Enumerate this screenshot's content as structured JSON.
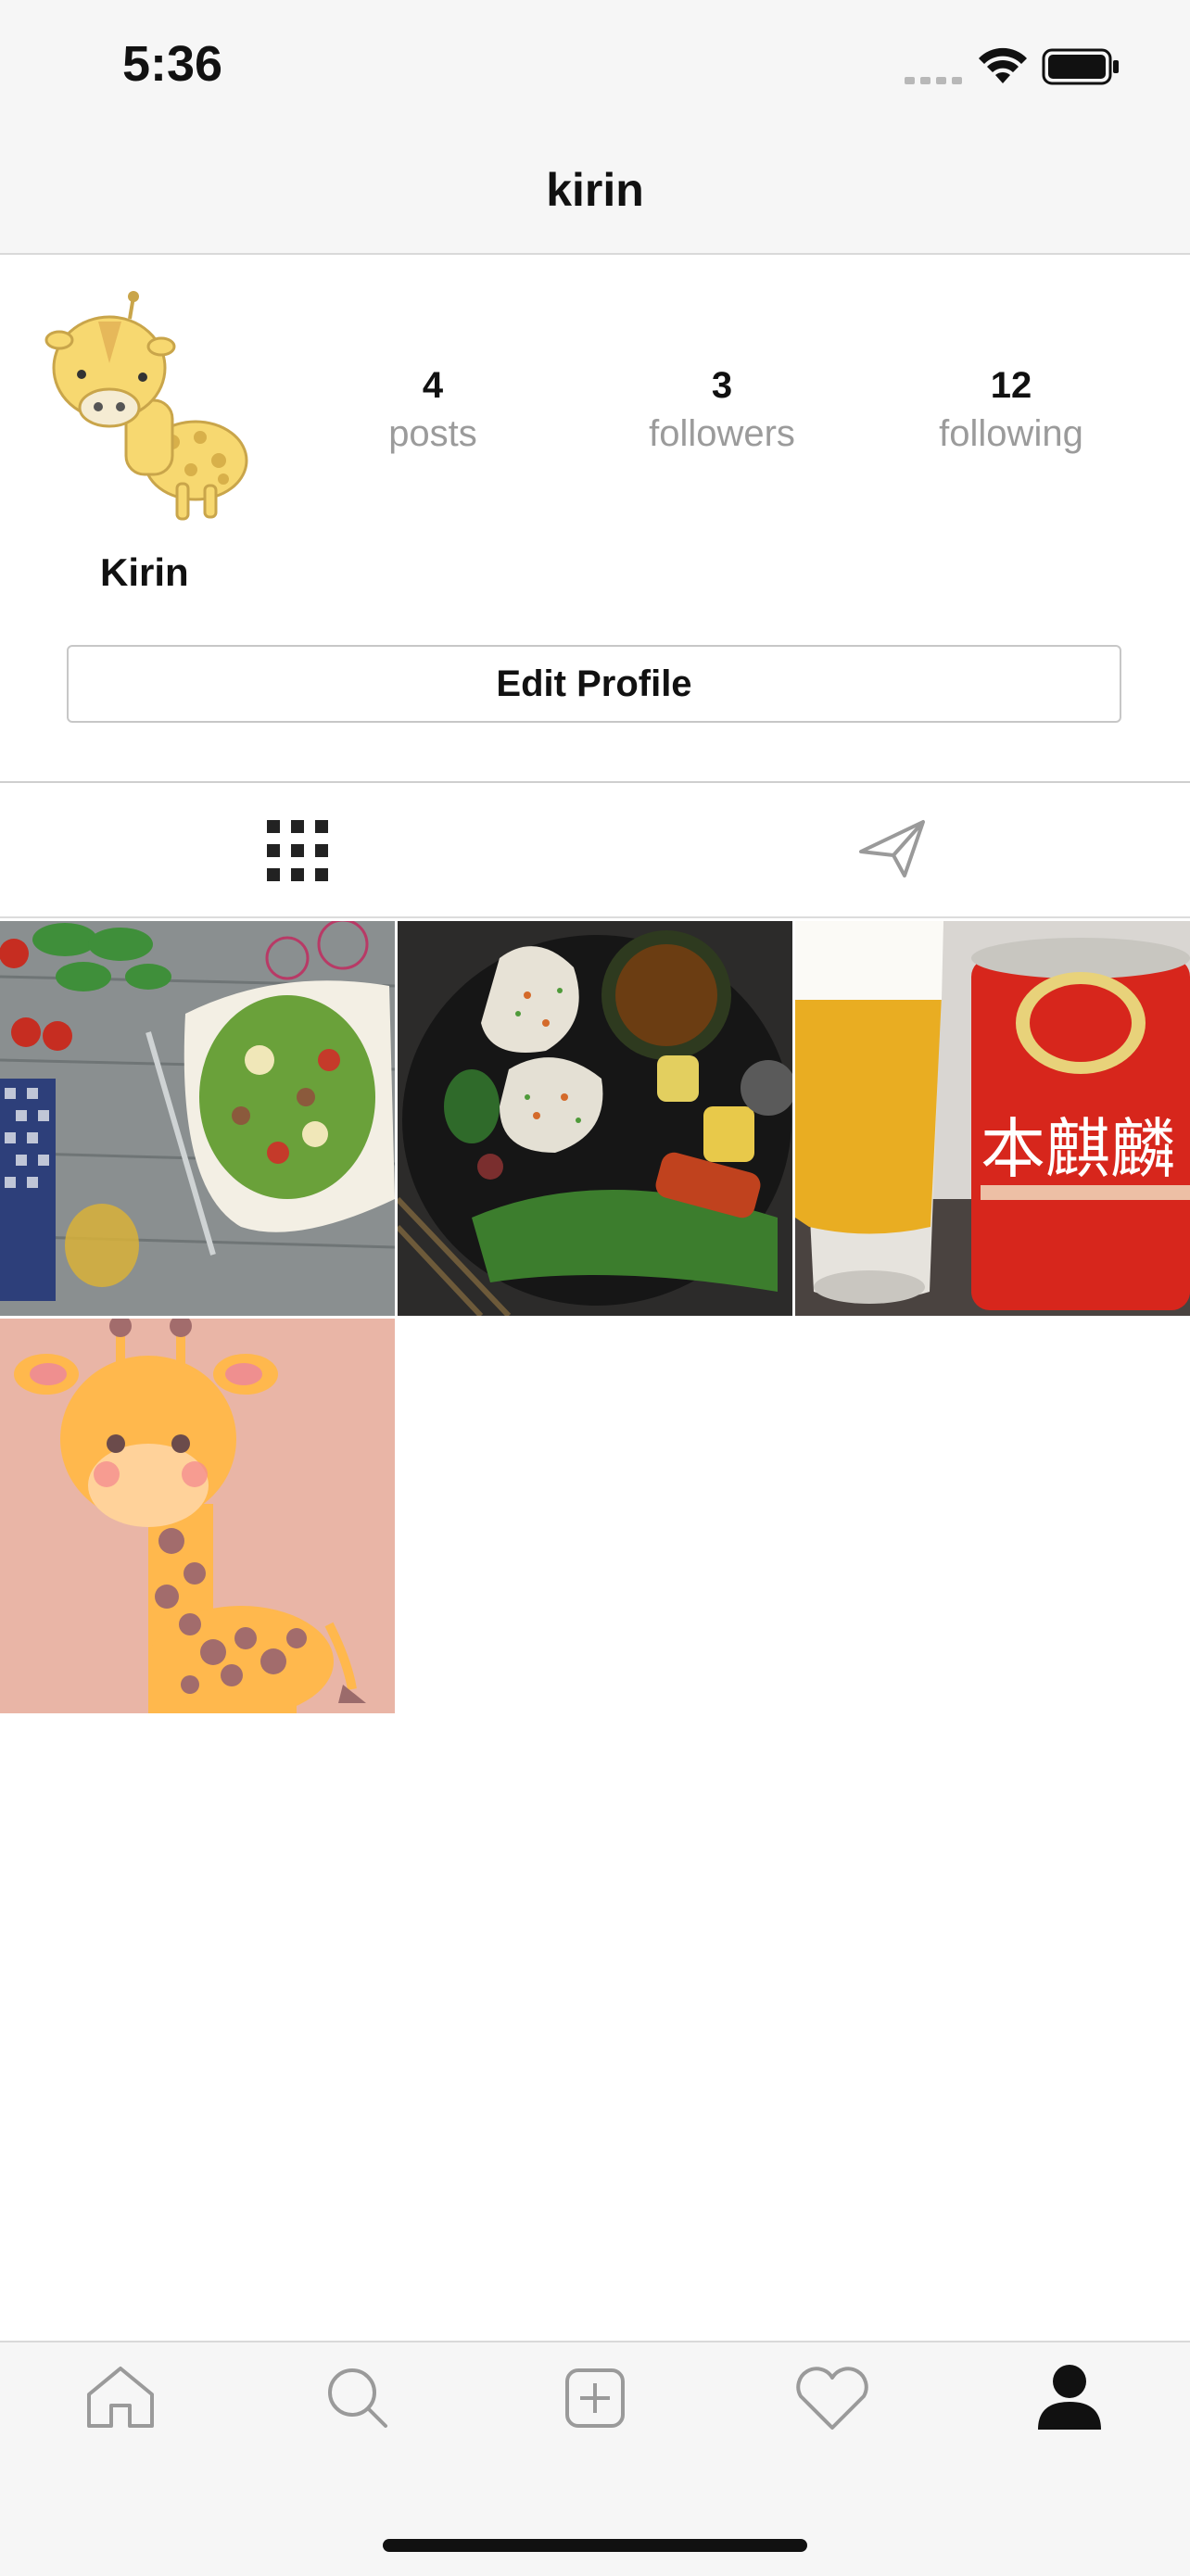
{
  "status_bar": {
    "time": "5:36"
  },
  "header": {
    "title": "kirin"
  },
  "profile": {
    "display_name": "Kirin",
    "stats": [
      {
        "value": "4",
        "label": "posts"
      },
      {
        "value": "3",
        "label": "followers"
      },
      {
        "value": "12",
        "label": "following"
      }
    ],
    "edit_button_label": "Edit Profile"
  },
  "tabs": [
    {
      "icon": "grid-icon",
      "active": true
    },
    {
      "icon": "paper-plane-icon",
      "active": false
    }
  ],
  "posts": [
    {
      "subject": "salad"
    },
    {
      "subject": "onigiri-plate"
    },
    {
      "subject": "beer"
    },
    {
      "subject": "giraffe"
    }
  ],
  "tab_bar": {
    "items": [
      "home-icon",
      "search-icon",
      "add-post-icon",
      "heart-icon",
      "profile-icon"
    ],
    "active": "profile-icon"
  },
  "colors": {
    "accent": "#111111",
    "muted_text": "#9b9b9b",
    "bar_bg": "#f6f6f6"
  }
}
